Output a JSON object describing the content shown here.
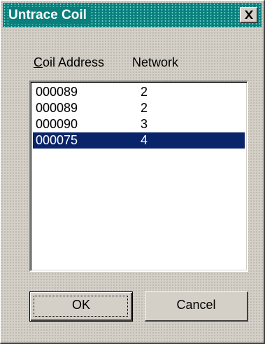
{
  "window": {
    "title": "Untrace Coil",
    "close_icon": "close-x-icon"
  },
  "list": {
    "headers": {
      "address_mnemonic": "C",
      "address_rest": "oil Address",
      "network": "Network"
    },
    "rows": [
      {
        "address": "000089",
        "network": "2"
      },
      {
        "address": "000089",
        "network": "2"
      },
      {
        "address": "000090",
        "network": "3"
      },
      {
        "address": "000075",
        "network": "4"
      }
    ],
    "selected_row": 3,
    "selection_color": "#0a246a"
  },
  "buttons": {
    "ok": "OK",
    "cancel": "Cancel"
  },
  "colors": {
    "titlebar": "#0a7f7c",
    "face": "#d4d0c8"
  }
}
